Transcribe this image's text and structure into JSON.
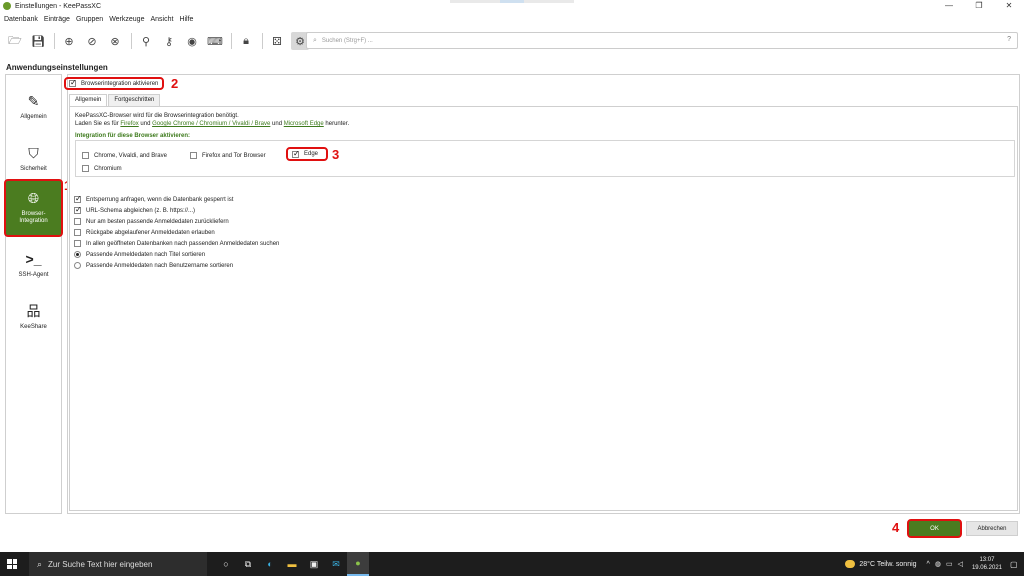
{
  "window": {
    "title": "Einstellungen - KeePassXC",
    "controls": {
      "minimize": "—",
      "maximize": "❐",
      "close": "✕"
    }
  },
  "menu": [
    "Datenbank",
    "Einträge",
    "Gruppen",
    "Werkzeuge",
    "Ansicht",
    "Hilfe"
  ],
  "toolbar": {
    "search_placeholder": "Suchen (Strg+F) ...",
    "help_label": "?"
  },
  "page_title": "Anwendungseinstellungen",
  "sidebar": {
    "items": [
      {
        "label": "Allgemein",
        "icon": "edit-icon"
      },
      {
        "label": "Sicherheit",
        "icon": "shield-icon"
      },
      {
        "label": "Browser-\nIntegration",
        "label_line1": "Browser-",
        "label_line2": "Integration",
        "icon": "globe-icon",
        "selected": true
      },
      {
        "label": "SSH-Agent",
        "icon": "terminal-icon"
      },
      {
        "label": "KeeShare",
        "icon": "network-icon"
      }
    ]
  },
  "enable_checkbox": {
    "label": "Browserintegration aktivieren",
    "checked": true
  },
  "tabs": [
    "Allgemein",
    "Fortgeschritten"
  ],
  "info": {
    "line1": "KeePassXC-Browser wird für die Browserintegration benötigt.",
    "line2_prefix": "Laden Sie es für",
    "link_firefox": "Firefox",
    "and1": "und",
    "link_chrome": "Google Chrome / Chromium / Vivaldi / Brave",
    "and2": "und",
    "link_edge": "Microsoft Edge",
    "suffix": "herunter."
  },
  "browsers_heading": "Integration für diese Browser aktivieren:",
  "browsers": [
    {
      "label": "Chrome, Vivaldi, and Brave",
      "checked": false
    },
    {
      "label": "Firefox and Tor Browser",
      "checked": false
    },
    {
      "label": "Edge",
      "checked": true
    },
    {
      "label": "Chromium",
      "checked": false
    }
  ],
  "options": [
    {
      "label": "Entsperrung anfragen, wenn die Datenbank gesperrt ist",
      "type": "checkbox",
      "checked": true
    },
    {
      "label": "URL-Schema abgleichen (z. B. https://...)",
      "type": "checkbox",
      "checked": true
    },
    {
      "label": "Nur am besten passende Anmeldedaten zurückliefern",
      "type": "checkbox",
      "checked": false
    },
    {
      "label": "Rückgabe abgelaufener Anmeldedaten erlauben",
      "type": "checkbox",
      "checked": false
    },
    {
      "label": "In allen geöffneten Datenbanken nach passenden Anmeldedaten suchen",
      "type": "checkbox",
      "checked": false
    },
    {
      "label": "Passende Anmeldedaten nach Titel sortieren",
      "type": "radio",
      "checked": true
    },
    {
      "label": "Passende Anmeldedaten nach Benutzername sortieren",
      "type": "radio",
      "checked": false
    }
  ],
  "buttons": {
    "ok": "OK",
    "cancel": "Abbrechen"
  },
  "annotations": [
    "1",
    "2",
    "3",
    "4"
  ],
  "taskbar": {
    "search_placeholder": "Zur Suche Text hier eingeben",
    "weather": "28°C  Teilw. sonnig",
    "time": "13:07",
    "date": "19.06.2021"
  },
  "colors": {
    "accent": "#4b7c20",
    "highlight": "#e01010",
    "link": "#3d7a1c"
  }
}
